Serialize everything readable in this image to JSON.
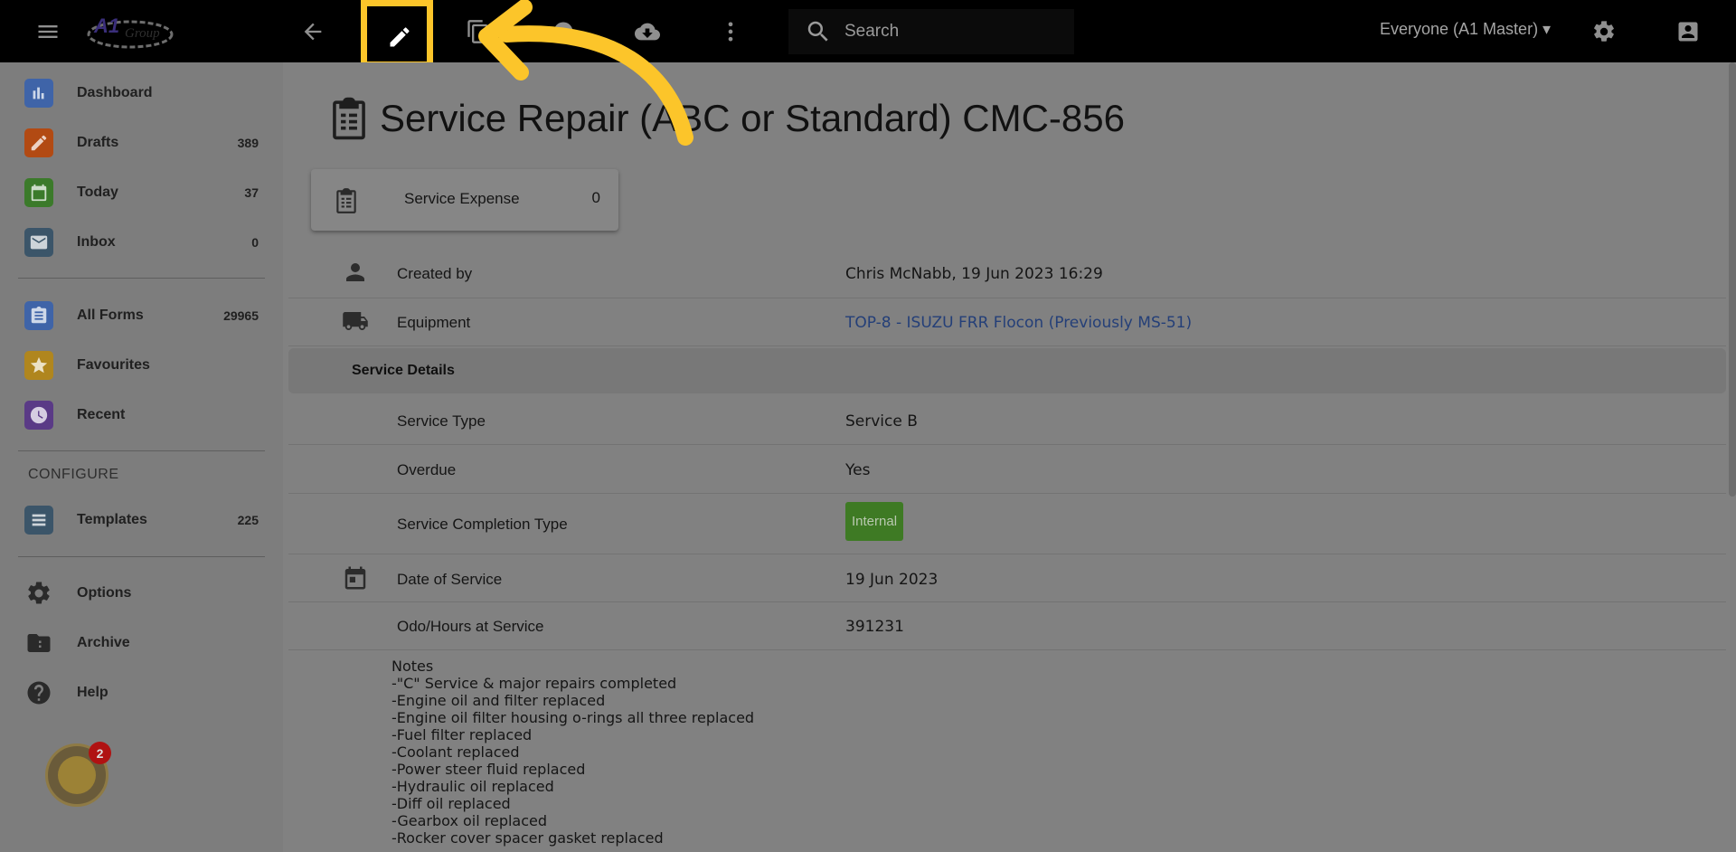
{
  "topbar": {
    "logo_text": "A1 Group",
    "search_placeholder": "Search",
    "workspace_label": "Everyone (A1 Master) ▾",
    "icons": [
      "menu-icon",
      "back-arrow-icon",
      "edit-pencil-icon",
      "copy-icon",
      "history-icon",
      "cloud-download-icon",
      "more-vert-icon",
      "search-icon",
      "settings-gear-icon",
      "account-box-icon"
    ],
    "highlight_color": "#fcc52a"
  },
  "sidebar": {
    "items": [
      {
        "label": "Dashboard",
        "count": "",
        "icon": "bar-chart-icon",
        "color": "#3f64a8"
      },
      {
        "label": "Drafts",
        "count": "389",
        "icon": "pencil-icon",
        "color": "#b24a13"
      },
      {
        "label": "Today",
        "count": "37",
        "icon": "calendar-icon",
        "color": "#3b7a2a"
      },
      {
        "label": "Inbox",
        "count": "0",
        "icon": "mail-icon",
        "color": "#3b5569"
      },
      {
        "label": "All Forms",
        "count": "29965",
        "icon": "clipboard-icon",
        "color": "#3f64a8"
      },
      {
        "label": "Favourites",
        "count": "",
        "icon": "star-icon",
        "color": "#b0861e"
      },
      {
        "label": "Recent",
        "count": "",
        "icon": "clock-icon",
        "color": "#5a3a86"
      }
    ],
    "configure_header": "CONFIGURE",
    "templates": {
      "label": "Templates",
      "count": "225",
      "icon": "list-icon",
      "color": "#3b5569"
    },
    "bottom_items": [
      {
        "label": "Options",
        "icon": "gear-icon"
      },
      {
        "label": "Archive",
        "icon": "archive-folder-icon"
      },
      {
        "label": "Help",
        "icon": "help-icon"
      }
    ],
    "bot_badge": "2"
  },
  "main": {
    "title": "Service Repair (ABC or Standard) CMC-856",
    "expense_card": {
      "label": "Service Expense",
      "value": "0"
    },
    "rows": [
      {
        "label": "Created by",
        "value": "Chris McNabb, 19 Jun 2023 16:29",
        "icon": "person-icon"
      },
      {
        "label": "Equipment",
        "value": "TOP-8 - ISUZU FRR Flocon (Previously MS-51)",
        "icon": "truck-icon",
        "link": true
      }
    ],
    "section_header": "Service Details",
    "details": [
      {
        "label": "Service Type",
        "value": "Service B"
      },
      {
        "label": "Overdue",
        "value": "Yes"
      },
      {
        "label": "Service Completion Type",
        "value": "Internal",
        "badge_color": "#3e7a24"
      },
      {
        "label": "Date of Service",
        "value": "19 Jun 2023",
        "icon": "calendar-icon"
      },
      {
        "label": "Odo/Hours at Service",
        "value": "391231"
      }
    ],
    "notes_label": "Notes",
    "notes_lines": [
      "-\"C\" Service & major repairs completed",
      "-Engine oil and filter replaced",
      "-Engine oil filter housing o-rings all three replaced",
      "-Fuel filter replaced",
      "-Coolant replaced",
      "-Power steer fluid replaced",
      "-Hydraulic oil replaced",
      "-Diff oil replaced",
      "-Gearbox oil replaced",
      "-Rocker cover spacer gasket replaced"
    ]
  },
  "annotation": {
    "arrow_color": "#fcc52a"
  }
}
